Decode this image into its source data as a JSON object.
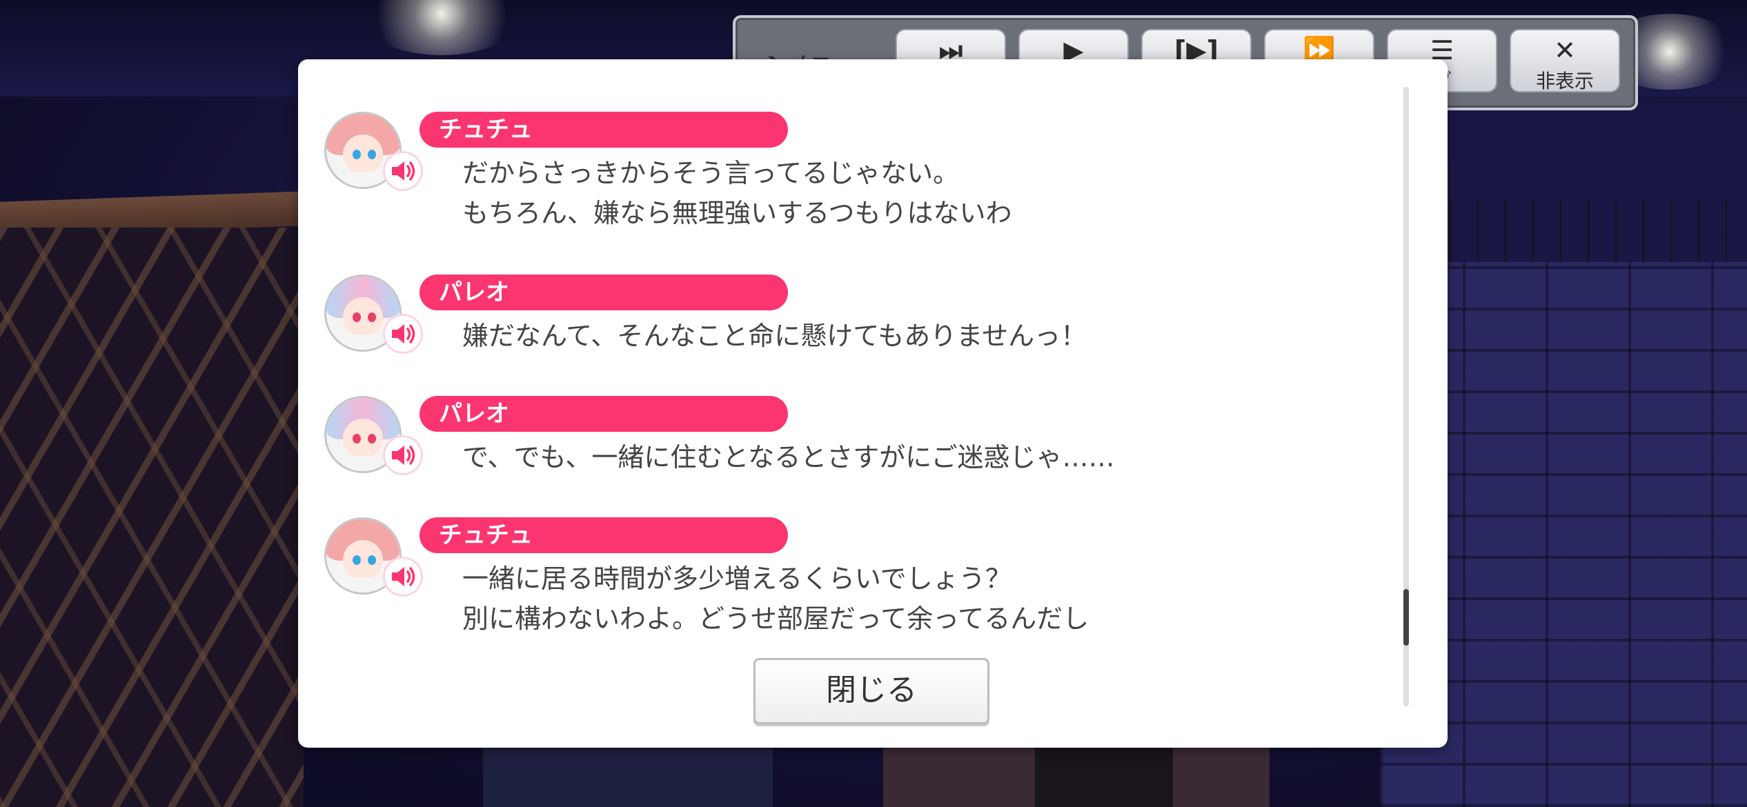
{
  "top_menu": {
    "menu_label": "メニュー",
    "buttons": [
      {
        "icon": "skip-icon",
        "glyph": "⏭",
        "label": ""
      },
      {
        "icon": "play-icon",
        "glyph": "▶",
        "label": ""
      },
      {
        "icon": "screen-toggle-icon",
        "glyph": "[▶]",
        "label": ""
      },
      {
        "icon": "fast-forward-icon",
        "glyph": "⏩",
        "label": ""
      },
      {
        "icon": "log-icon",
        "glyph": "☰",
        "label": "ブ"
      },
      {
        "icon": "close-x-icon",
        "glyph": "✕",
        "label": "非表示"
      }
    ]
  },
  "log": {
    "entries": [
      {
        "speaker": "チュチュ",
        "lines": [
          "だからさっきからそう言ってるじゃない。",
          "もちろん、嫌なら無理強いするつもりはないわ"
        ]
      },
      {
        "speaker": "パレオ",
        "lines": [
          "嫌だなんて、そんなこと命に懸けてもありませんっ！"
        ]
      },
      {
        "speaker": "パレオ",
        "lines": [
          "で、でも、一緒に住むとなるとさすがにご迷惑じゃ……"
        ]
      },
      {
        "speaker": "チュチュ",
        "lines": [
          "一緒に居る時間が多少増えるくらいでしょう？",
          "別に構わないわよ。どうせ部屋だって余ってるんだし"
        ]
      }
    ],
    "close_label": "閉じる"
  },
  "colors": {
    "name_bar": "#fb3570",
    "voice_icon": "#fb3570",
    "text": "#444444"
  }
}
